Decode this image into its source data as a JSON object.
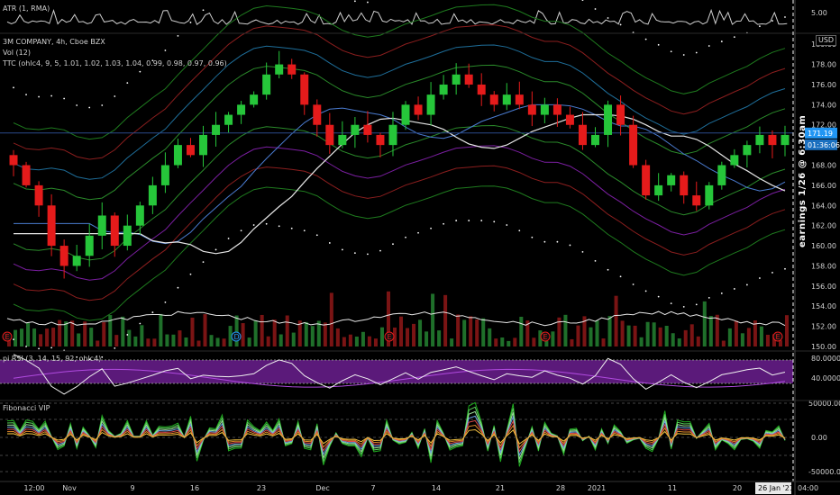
{
  "indicators": {
    "atr_label": "ATR (1, RMA)",
    "symbol_label": "3M COMPANY, 4h, Cboe BZX",
    "vol_label": "Vol (12)",
    "ttc_label": "TTC (ohlc4, 9, 5, 1.01, 1.02, 1.03, 1.04, 0.99, 0.98, 0.97, 0.96)",
    "rsi_label": "pi RSI (3, 14, 15, 92, ohlc4)",
    "fib_label": "Fibonacci VIP"
  },
  "currency_badge": "USD",
  "earnings_note": "earnings 1/26 @ 6:30am",
  "current_date_badge": "26 Jan '21",
  "time_badge": "04:00",
  "price_tags": {
    "last_price": "171.19",
    "countdown": "01:36:06"
  },
  "earnings_markers": [
    "E",
    "E",
    "E",
    "E",
    "E"
  ],
  "dividend_markers": [
    "D"
  ],
  "colors": {
    "up": "#26c63a",
    "down": "#e51b1b",
    "rsi_band": "#6b1e8f",
    "price_tag": "#2196f3"
  },
  "chart_data": [
    {
      "type": "line",
      "name": "ATR",
      "yaxis_ticks": [
        "5.00"
      ],
      "ylim": [
        0,
        7
      ]
    },
    {
      "type": "candlestick",
      "ylim": [
        150,
        181
      ],
      "yaxis_ticks": [
        "180.00",
        "178.00",
        "176.00",
        "174.00",
        "172.00",
        "170.00",
        "168.00",
        "166.00",
        "164.00",
        "162.00",
        "160.00",
        "158.00",
        "156.00",
        "154.00",
        "152.00",
        "150.00"
      ],
      "x_tick_labels": [
        "12:00",
        "Nov",
        "9",
        "16",
        "23",
        "Dec",
        "7",
        "14",
        "21",
        "28",
        "2021",
        "11",
        "20",
        "26 Jan '21",
        "04:00"
      ],
      "close_estimates": [
        168,
        166,
        164,
        160,
        158,
        159,
        161,
        163,
        160,
        162,
        164,
        166,
        168,
        170,
        169,
        171,
        172,
        173,
        174,
        175,
        177,
        178,
        177,
        174,
        172,
        170,
        171,
        172,
        171,
        170,
        172,
        174,
        173,
        175,
        176,
        177,
        176,
        175,
        174,
        175,
        174,
        173,
        174,
        173,
        172,
        170,
        171,
        174,
        172,
        168,
        165,
        166,
        167,
        165,
        164,
        166,
        168,
        169,
        170,
        171,
        170,
        171
      ],
      "last_price": 171.19
    },
    {
      "type": "line",
      "name": "RSI",
      "yaxis_ticks": [
        "80.0000",
        "40.0000"
      ],
      "ylim": [
        0,
        100
      ]
    },
    {
      "type": "line",
      "name": "Fibonacci VIP",
      "yaxis_ticks": [
        "50000.00",
        "0.00",
        "-50000.00"
      ]
    }
  ]
}
